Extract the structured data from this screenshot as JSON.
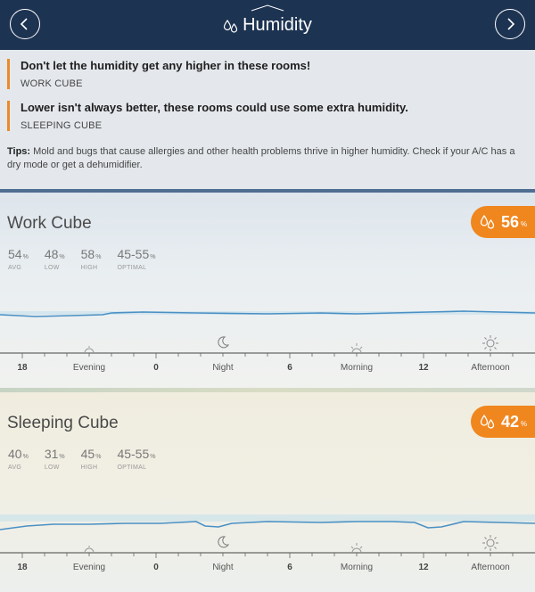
{
  "header": {
    "title": "Humidity",
    "prev_label": "previous",
    "next_label": "next"
  },
  "alerts": [
    {
      "message": "Don't let the humidity get any higher in these rooms!",
      "room": "WORK CUBE"
    },
    {
      "message": "Lower isn't always better, these rooms could use some extra humidity.",
      "room": "SLEEPING CUBE"
    }
  ],
  "tips": {
    "label": "Tips:",
    "text": " Mold and bugs that cause allergies and other health problems thrive in higher humidity. Check if your A/C has a dry mode or get a dehumidifier."
  },
  "colors": {
    "header": "#1d3352",
    "accent": "#f0861e",
    "line": "#4a90c4"
  },
  "rooms": [
    {
      "name": "Work Cube",
      "current": "56",
      "current_unit": "%",
      "stats": [
        {
          "value": "54",
          "unit": "%",
          "label": "AVG"
        },
        {
          "value": "48",
          "unit": "%",
          "label": "LOW"
        },
        {
          "value": "58",
          "unit": "%",
          "label": "HIGH"
        },
        {
          "value": "45-55",
          "unit": "%",
          "label": "OPTIMAL"
        }
      ]
    },
    {
      "name": "Sleeping Cube",
      "current": "42",
      "current_unit": "%",
      "stats": [
        {
          "value": "40",
          "unit": "%",
          "label": "AVG"
        },
        {
          "value": "31",
          "unit": "%",
          "label": "LOW"
        },
        {
          "value": "45",
          "unit": "%",
          "label": "HIGH"
        },
        {
          "value": "45-55",
          "unit": "%",
          "label": "OPTIMAL"
        }
      ]
    }
  ],
  "timeline": {
    "labels": [
      "18",
      "Evening",
      "0",
      "Night",
      "6",
      "Morning",
      "12",
      "Afternoon"
    ],
    "icons": [
      "sunset-icon",
      "moon-icon",
      "sunrise-icon",
      "sun-icon"
    ]
  }
}
